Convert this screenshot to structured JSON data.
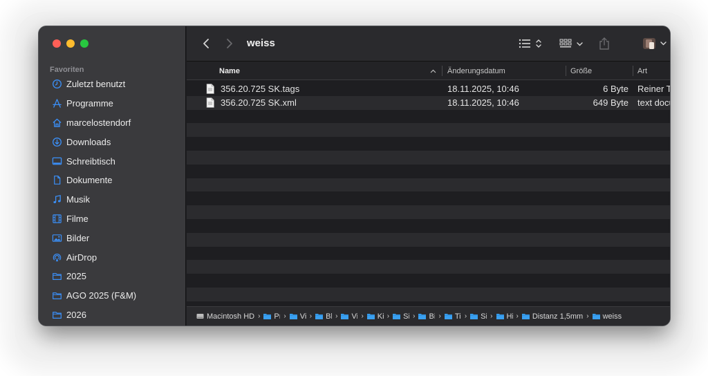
{
  "window": {
    "title": "weiss"
  },
  "sidebar": {
    "heading": "Favoriten",
    "items": [
      {
        "label": "Zuletzt benutzt",
        "icon": "clock-icon"
      },
      {
        "label": "Programme",
        "icon": "applications-icon"
      },
      {
        "label": "marcelostendorf",
        "icon": "home-icon"
      },
      {
        "label": "Downloads",
        "icon": "download-icon"
      },
      {
        "label": "Schreibtisch",
        "icon": "desktop-icon"
      },
      {
        "label": "Dokumente",
        "icon": "document-icon"
      },
      {
        "label": "Musik",
        "icon": "music-icon"
      },
      {
        "label": "Filme",
        "icon": "film-icon"
      },
      {
        "label": "Bilder",
        "icon": "photo-icon"
      },
      {
        "label": "AirDrop",
        "icon": "airdrop-icon"
      },
      {
        "label": "2025",
        "icon": "folder-icon"
      },
      {
        "label": "AGO 2025 (F&M)",
        "icon": "folder-icon"
      },
      {
        "label": "2026",
        "icon": "folder-icon"
      }
    ]
  },
  "columns": {
    "name": "Name",
    "date": "Änderungsdatum",
    "size": "Größe",
    "kind": "Art"
  },
  "files": [
    {
      "name": "356.20.725 SK.tags",
      "date": "18.11.2025, 10:46",
      "size": "6 Byte",
      "kind": "Reiner Text"
    },
    {
      "name": "356.20.725 SK.xml",
      "date": "18.11.2025, 10:46",
      "size": "649 Byte",
      "kind": "text document"
    }
  ],
  "pathbar": {
    "root": "Macintosh HD",
    "crumbs": [
      "Pr",
      "Vi",
      "Bl",
      "Vi",
      "Ki",
      "Si",
      "Bi",
      "Ti",
      "Si",
      "Hi"
    ],
    "parent": "Distanz 1,5mm",
    "current": "weiss"
  },
  "colors": {
    "accent": "#3b8ff7",
    "folder": "#3aa0f0"
  }
}
